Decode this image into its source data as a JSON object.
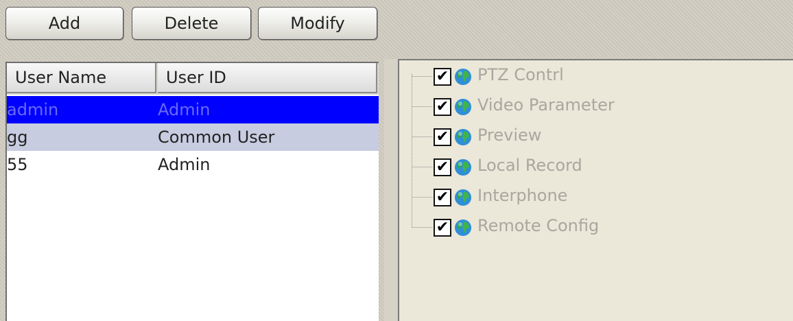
{
  "toolbar": {
    "add_label": "Add",
    "delete_label": "Delete",
    "modify_label": "Modify"
  },
  "user_list": {
    "columns": [
      "User Name",
      "User ID"
    ],
    "selected_index": 0,
    "rows": [
      {
        "name": "admin",
        "id": "Admin"
      },
      {
        "name": "gg",
        "id": "Common User"
      },
      {
        "name": "55",
        "id": "Admin"
      }
    ]
  },
  "permissions": {
    "items": [
      {
        "label": "PTZ Contrl",
        "checked": true,
        "icon": "globe-icon"
      },
      {
        "label": "Video Parameter",
        "checked": true,
        "icon": "globe-icon"
      },
      {
        "label": "Preview",
        "checked": true,
        "icon": "globe-icon"
      },
      {
        "label": "Local Record",
        "checked": true,
        "icon": "globe-icon"
      },
      {
        "label": "Interphone",
        "checked": true,
        "icon": "globe-icon"
      },
      {
        "label": "Remote Config",
        "checked": true,
        "icon": "globe-icon"
      }
    ]
  },
  "colors": {
    "selection": "#0000ff",
    "row_highlight": "#c8cce0",
    "disabled_text": "#a9a79e"
  }
}
